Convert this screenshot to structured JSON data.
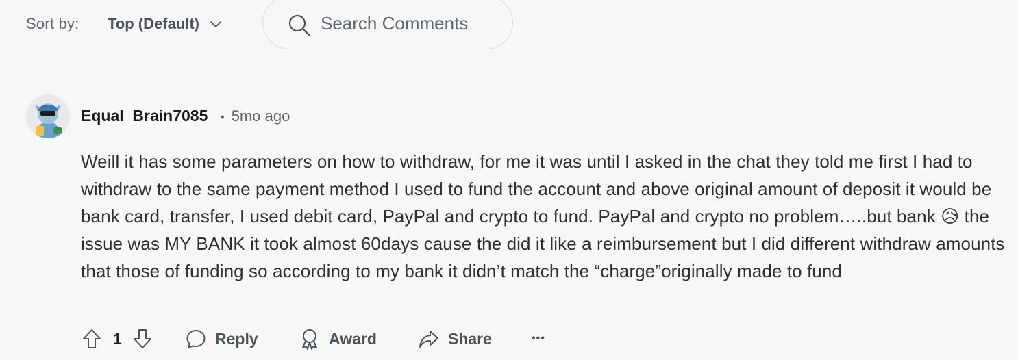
{
  "toolbar": {
    "sort_label": "Sort by:",
    "sort_value": "Top (Default)",
    "search_placeholder": "Search Comments"
  },
  "comment": {
    "username": "Equal_Brain7085",
    "separator": "•",
    "time_ago": "5mo ago",
    "body_before_emoji": "Weill it has some parameters on how to withdraw, for me it was until I asked in the chat they told me first I had to withdraw to the same payment method I used to fund the account and above original amount of deposit it would be bank card, transfer, I used debit card, PayPal and crypto to fund. PayPal and crypto no problem…..but bank ",
    "emoji": "😥",
    "body_after_emoji": " the issue was MY BANK it took almost 60days cause the did it like a reimbursement but I did different withdraw amounts that those of funding so according to my bank it didn’t match the “charge”originally made to fund",
    "vote_count": "1",
    "actions": {
      "reply": "Reply",
      "award": "Award",
      "share": "Share",
      "more": "•••"
    }
  },
  "icons": {
    "sort": "chevron-down-icon",
    "search": "search-icon",
    "upvote": "arrow-up-icon",
    "downvote": "arrow-down-icon",
    "reply": "speech-bubble-icon",
    "award": "award-ribbon-icon",
    "share": "share-arrow-icon",
    "more": "ellipsis-icon"
  },
  "colors": {
    "background": "#f7f7f8",
    "muted_text": "#5c6770",
    "body_text": "#2a3136",
    "border": "#d7dadc"
  }
}
